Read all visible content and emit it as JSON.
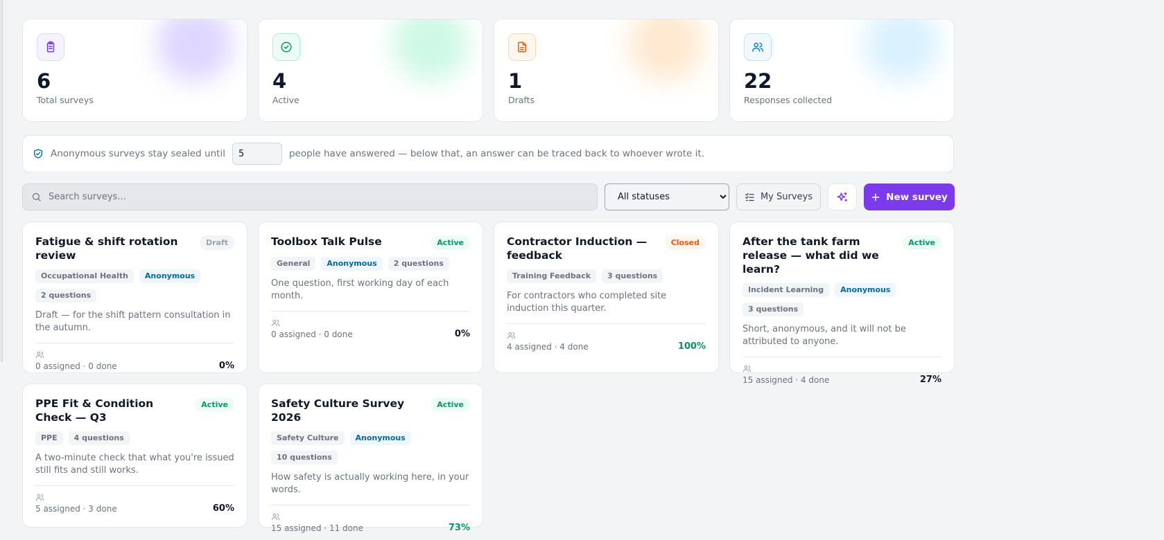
{
  "stats": [
    {
      "value": "6",
      "label": "Total surveys",
      "icon": "clipboard-icon",
      "accent": "#7c3aed"
    },
    {
      "value": "4",
      "label": "Active",
      "icon": "check-circle-icon",
      "accent": "#059669"
    },
    {
      "value": "1",
      "label": "Drafts",
      "icon": "document-icon",
      "accent": "#ea580c"
    },
    {
      "value": "22",
      "label": "Responses collected",
      "icon": "users-icon",
      "accent": "#0284c7"
    }
  ],
  "notice": {
    "before": "Anonymous surveys stay sealed until",
    "value": "5",
    "after": "people have answered — below that, an answer can be traced back to whoever wrote it."
  },
  "toolbar": {
    "search_placeholder": "Search surveys...",
    "status_selected": "All statuses",
    "my_surveys_label": "My Surveys",
    "new_survey_label": "New survey"
  },
  "surveys": [
    {
      "title": "Fatigue & shift rotation review",
      "status": "Draft",
      "tags": [
        "Occupational Health",
        "Anonymous",
        "2 questions"
      ],
      "description": "Draft — for the shift pattern consultation in the autumn.",
      "footer": "0 assigned · 0 done",
      "percent": "0%"
    },
    {
      "title": "Toolbox Talk Pulse",
      "status": "Active",
      "tags": [
        "General",
        "Anonymous",
        "2 questions"
      ],
      "description": "One question, first working day of each month.",
      "footer": "0 assigned · 0 done",
      "percent": "0%"
    },
    {
      "title": "Contractor Induction — feedback",
      "status": "Closed",
      "tags": [
        "Training Feedback",
        "3 questions"
      ],
      "description": "For contractors who completed site induction this quarter.",
      "footer": "4 assigned · 4 done",
      "percent": "100%"
    },
    {
      "title": "After the tank farm release — what did we learn?",
      "status": "Active",
      "tags": [
        "Incident Learning",
        "Anonymous",
        "3 questions"
      ],
      "description": "Short, anonymous, and it will not be attributed to anyone.",
      "footer": "15 assigned · 4 done",
      "percent": "27%"
    },
    {
      "title": "PPE Fit & Condition Check — Q3",
      "status": "Active",
      "tags": [
        "PPE",
        "4 questions"
      ],
      "description": "A two-minute check that what you're issued still fits and still works.",
      "footer": "5 assigned · 3 done",
      "percent": "60%"
    },
    {
      "title": "Safety Culture Survey 2026",
      "status": "Active",
      "tags": [
        "Safety Culture",
        "Anonymous",
        "10 questions"
      ],
      "description": "How safety is actually working here, in your words.",
      "footer": "15 assigned · 11 done",
      "percent": "73%"
    }
  ]
}
